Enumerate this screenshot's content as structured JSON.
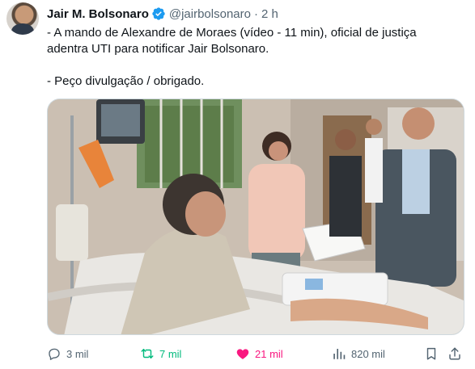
{
  "author": {
    "name": "Jair M. Bolsonaro",
    "handle": "@jairbolsonaro",
    "separator": "·",
    "time": "2 h",
    "verified_icon": "verified-badge-icon",
    "verified_color": "#1d9bf0"
  },
  "tweet": {
    "lines": [
      "- A mando de Alexandre de Moraes (vídeo - 11 min), oficial de justiça",
      "adentra UTI para notificar Jair Bolsonaro.",
      "- Peço divulgação / obrigado."
    ]
  },
  "actions": {
    "reply": {
      "count": "3 mil",
      "icon": "reply-icon"
    },
    "retweet": {
      "count": "7 mil",
      "icon": "retweet-icon",
      "color": "#00ba7c"
    },
    "like": {
      "count": "21 mil",
      "icon": "heart-icon",
      "color": "#f91880"
    },
    "views": {
      "count": "820 mil",
      "icon": "views-icon"
    },
    "bookmark": {
      "icon": "bookmark-icon"
    },
    "share": {
      "icon": "share-icon"
    }
  },
  "colors": {
    "text": "#0f1419",
    "secondary": "#536471",
    "border": "#cfd9de"
  }
}
